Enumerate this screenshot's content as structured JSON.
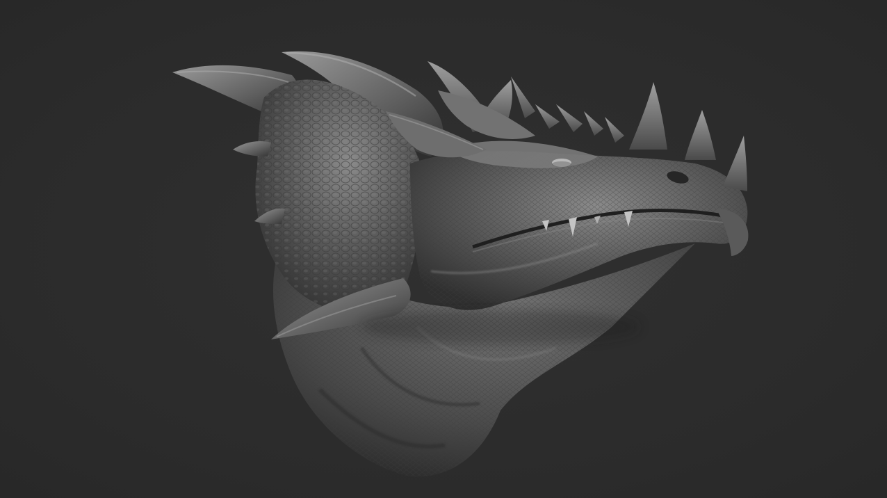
{
  "scene": {
    "subject": "dragon-head-sculpt",
    "render_style": "matcap-clay",
    "colors": {
      "background": "#2c2c2c",
      "clay_base": "#6a6a6a",
      "clay_light": "#a8a8a8",
      "clay_shadow": "#2a2a2a"
    }
  }
}
